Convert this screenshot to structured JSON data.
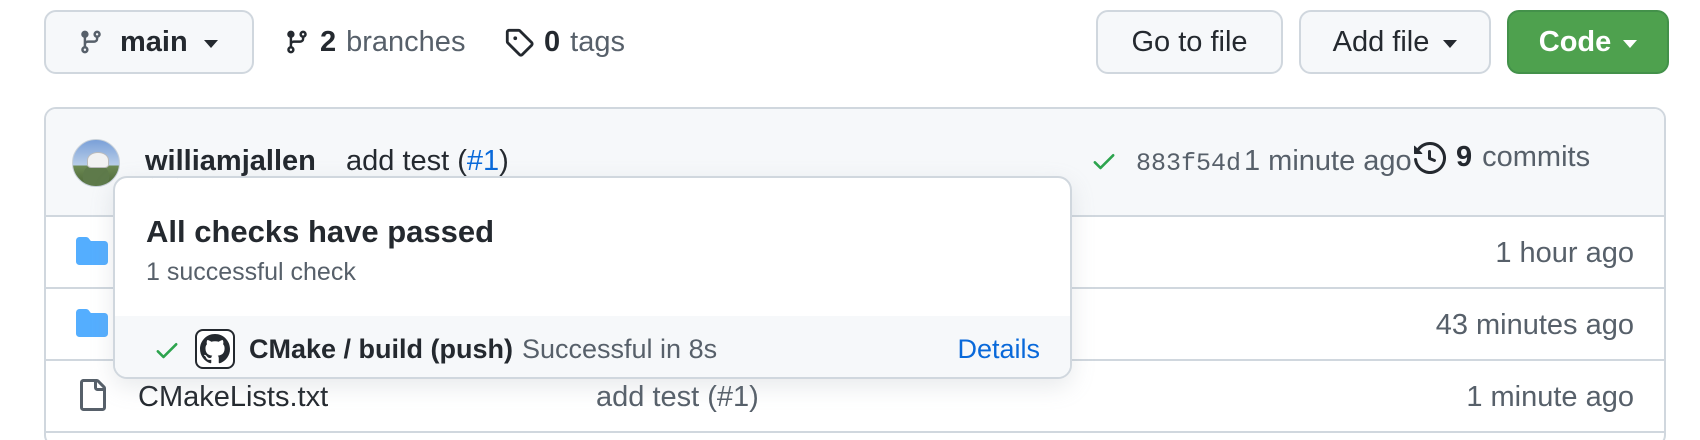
{
  "toolbar": {
    "branch_label": "main",
    "branches_count": "2",
    "branches_label": "branches",
    "tags_count": "0",
    "tags_label": "tags",
    "go_to_file_label": "Go to file",
    "add_file_label": "Add file",
    "code_label": "Code"
  },
  "commit": {
    "author": "williamjallen",
    "message": "add test (",
    "pr_link": "#1",
    "message_end": ")",
    "sha": "883f54d",
    "time": "1 minute ago",
    "commits_count": "9",
    "commits_label": "commits"
  },
  "files": [
    {
      "type": "folder",
      "name": "",
      "message": "",
      "time": "1 hour ago"
    },
    {
      "type": "folder",
      "name": "",
      "message": "",
      "time": "43 minutes ago"
    },
    {
      "type": "file",
      "name": "CMakeLists.txt",
      "message": "add test (#1)",
      "time": "1 minute ago"
    }
  ],
  "popover": {
    "title": "All checks have passed",
    "subtitle": "1 successful check",
    "check_name": "CMake / build (push)",
    "check_status": "Successful in 8s",
    "details_label": "Details"
  },
  "colors": {
    "accent_green": "#4ea14e",
    "link_blue": "#0969da",
    "folder_blue": "#54aeff"
  }
}
